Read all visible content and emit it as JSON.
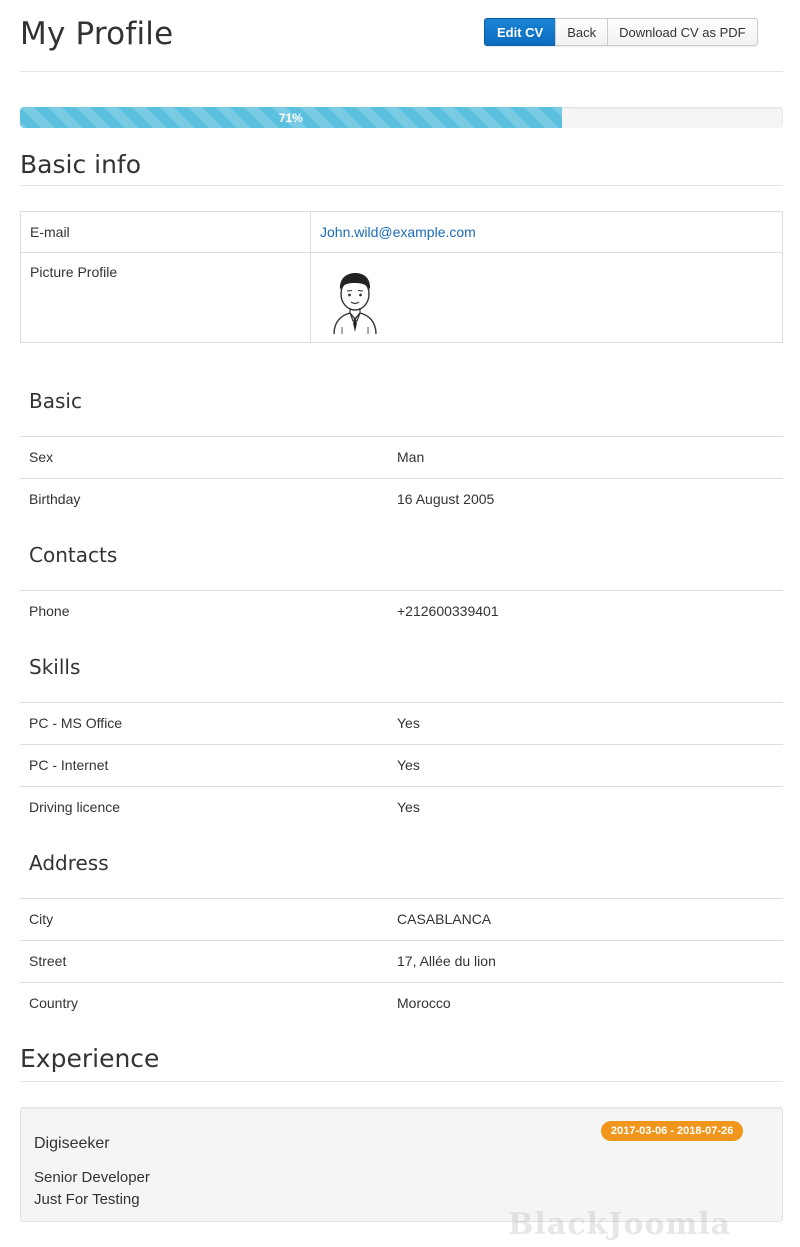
{
  "header": {
    "title": "My Profile",
    "buttons": {
      "edit": "Edit CV",
      "back": "Back",
      "download": "Download CV as PDF"
    }
  },
  "progress": {
    "value": 71,
    "label": "71%"
  },
  "basic_info": {
    "heading": "Basic info",
    "email_label": "E-mail",
    "email_value": "John.wild@example.com",
    "picture_label": "Picture Profile",
    "picture_icon": "avatar-icon"
  },
  "groups": {
    "basic": {
      "heading": "Basic",
      "rows": [
        {
          "label": "Sex",
          "value": "Man"
        },
        {
          "label": "Birthday",
          "value": "16 August 2005"
        }
      ]
    },
    "contacts": {
      "heading": "Contacts",
      "rows": [
        {
          "label": "Phone",
          "value": "+212600339401"
        }
      ]
    },
    "skills": {
      "heading": "Skills",
      "rows": [
        {
          "label": "PC - MS Office",
          "value": "Yes"
        },
        {
          "label": "PC - Internet",
          "value": "Yes"
        },
        {
          "label": "Driving licence",
          "value": "Yes"
        }
      ]
    },
    "address": {
      "heading": "Address",
      "rows": [
        {
          "label": "City",
          "value": "CASABLANCA"
        },
        {
          "label": "Street",
          "value": "17, Allée du lion"
        },
        {
          "label": "Country",
          "value": "Morocco"
        }
      ]
    }
  },
  "experience": {
    "heading": "Experience",
    "items": [
      {
        "company": "Digiseeker",
        "dates": "2017-03-06 - 2018-07-26",
        "position": "Senior Developer",
        "description": "Just For Testing"
      }
    ]
  },
  "watermark": "BlackJoomla",
  "colors": {
    "primary_button": "#0b6cbf",
    "progress": "#5bc0de",
    "badge": "#f0961c",
    "link": "#1a6bb8"
  }
}
